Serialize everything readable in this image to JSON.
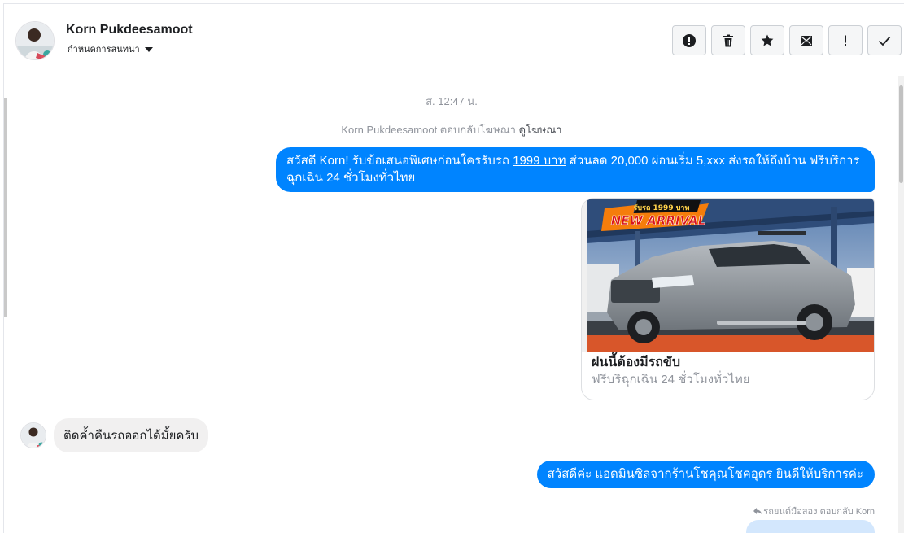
{
  "header": {
    "contact_name": "Korn Pukdeesamoot",
    "assign_label": "กำหนดการสนทนา",
    "toolbar": [
      {
        "name": "mark-spam-button",
        "icon": "alert-circle-icon"
      },
      {
        "name": "delete-button",
        "icon": "trash-icon"
      },
      {
        "name": "star-button",
        "icon": "star-icon"
      },
      {
        "name": "mark-unread-button",
        "icon": "envelope-icon"
      },
      {
        "name": "follow-up-button",
        "icon": "exclamation-icon"
      },
      {
        "name": "mark-done-button",
        "icon": "check-icon"
      }
    ]
  },
  "thread": {
    "timestamp": "ส. 12:47 น.",
    "ad_note": {
      "text": "Korn Pukdeesamoot ตอบกลับโฆษณา",
      "link": "ดูโฆษณา"
    },
    "messages": {
      "out1_a": "สวัสดี Korn! รับข้อเสนอพิเศษก่อนใครรับรถ ",
      "out1_price": "1999 บาท",
      "out1_b": " ส่วนลด 20,000 ผ่อนเริ่ม 5,xxx ส่งรถให้ถึงบ้าน ฟรีบริการฉุกเฉิน 24 ชั่วโมงทั่วไทย",
      "out1_line1_end": "ฟรีบริ",
      "card": {
        "badge_top": "รับรถ 1999 บาท",
        "badge_main": "NEW ARRIVAL",
        "title": "ฝนนี้ต้องมีรถขับ",
        "subtitle": "ฟรีบริฉุกเฉิน 24 ชั่วโมงทั่วไทย"
      },
      "in1": "ติดค้ำคืนรถออกได้มั้ยครับ",
      "out2": "สวัสดีค่ะ แอดมินซิลจากร้านโชคุณโชคอุดร ยินดีให้บริการค่ะ",
      "reply_note": "รถยนต์มือสอง ตอบกลับ Korn"
    }
  },
  "colors": {
    "accent": "#0084ff",
    "bubble_in": "#f1f0f0",
    "muted_text": "#90949c"
  }
}
